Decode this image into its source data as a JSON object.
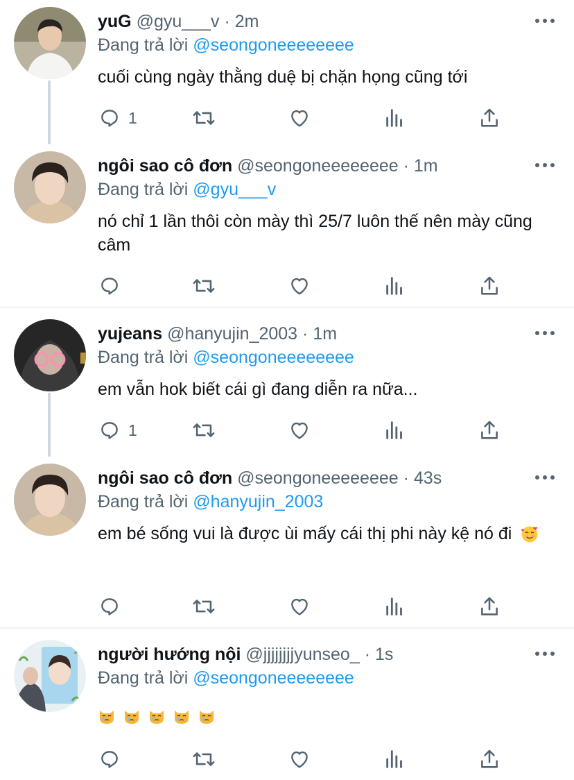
{
  "reply_prefix": "Đang trả lời",
  "tweets": [
    {
      "name": "yuG",
      "handle": "@gyu___v",
      "time": "2m",
      "reply_to": "@seongoneeeeeeee",
      "text": "cuối cùng ngày thằng duệ bị chặn họng cũng tới",
      "reply_count": "1"
    },
    {
      "name": "ngôi sao cô đơn",
      "handle": "@seongoneeeeeeee",
      "time": "1m",
      "reply_to": "@gyu___v",
      "text": "nó chỉ 1 lần thôi còn mày thì 25/7 luôn thế nên mày cũng câm",
      "reply_count": ""
    },
    {
      "name": "yujeans",
      "handle": "@hanyujin_2003",
      "time": "1m",
      "reply_to": "@seongoneeeeeeee",
      "text": "em vẫn hok biết cái gì đang diễn ra nữa...",
      "reply_count": "1"
    },
    {
      "name": "ngôi sao cô đơn",
      "handle": "@seongoneeeeeeee",
      "time": "43s",
      "reply_to": "@hanyujin_2003",
      "text": "em bé sống vui là được ùi mấy cái thị phi này kệ nó đi",
      "text_emoji": "smiling-face-with-hearts",
      "reply_count": ""
    },
    {
      "name": "người hướng nội",
      "handle": "@jjjjjjjjyunseo_",
      "time": "1s",
      "reply_to": "@seongoneeeeeeee",
      "text": "",
      "emoji_row": [
        "crying-cat-face",
        "crying-cat-face",
        "crying-cat-face",
        "crying-cat-face",
        "crying-cat-face"
      ],
      "reply_count": ""
    }
  ],
  "colors": {
    "link": "#1d9bf0",
    "muted": "#536471",
    "thread_line": "#cfd9de"
  }
}
